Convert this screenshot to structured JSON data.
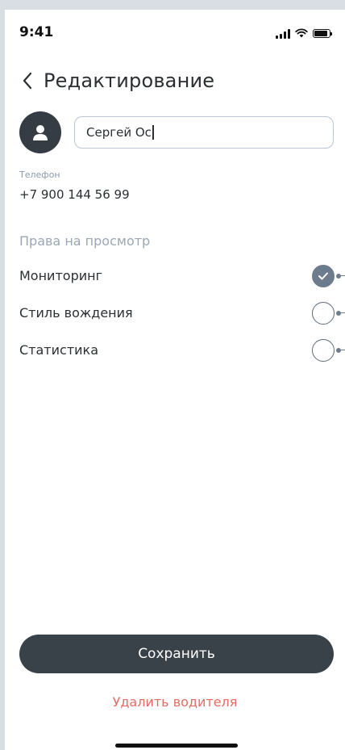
{
  "status_bar": {
    "time": "9:41"
  },
  "header": {
    "title": "Редактирование"
  },
  "profile": {
    "name_value": "Сергей Ос"
  },
  "phone": {
    "label": "Телефон",
    "value": "+7 900 144 56 99"
  },
  "rights": {
    "heading": "Права на просмотр",
    "items": [
      {
        "label": "Мониторинг",
        "checked": true
      },
      {
        "label": "Стиль вождения",
        "checked": false
      },
      {
        "label": "Статистика",
        "checked": false
      }
    ]
  },
  "actions": {
    "save_label": "Сохранить",
    "delete_label": "Удалить водителя"
  },
  "colors": {
    "accent_dark": "#3a4249",
    "danger": "#e56b63",
    "muted": "#9aa7b5",
    "check": "#6d7c8c"
  }
}
